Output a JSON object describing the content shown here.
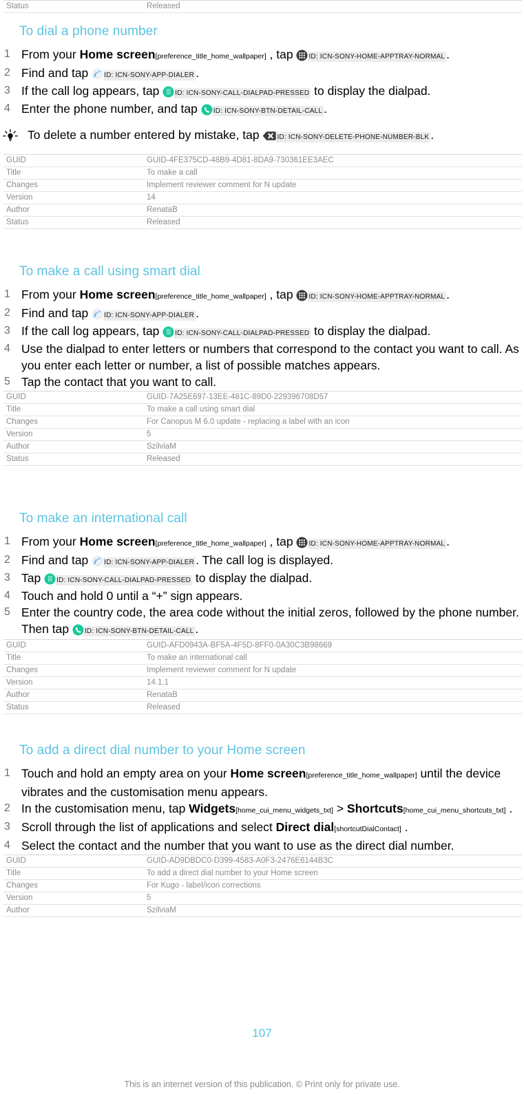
{
  "document": {
    "page_number": "107",
    "footer_note": "This is an internet version of this publication. © Print only for private use.",
    "heading_color": "#5cc3e0",
    "meta_text_color": "#8c8c8c"
  },
  "top_partial_table": {
    "rows": [
      {
        "key": "Status",
        "value": "Released"
      }
    ]
  },
  "sections": [
    {
      "id": "dial-a-phone-number",
      "heading": "To dial a phone number",
      "steps": [
        {
          "parts": [
            {
              "type": "text",
              "text": "From your "
            },
            {
              "type": "uilabel",
              "text": "Home screen"
            },
            {
              "type": "token",
              "text": "[preference_title_home_wallpaper]"
            },
            {
              "type": "text",
              "text": ", tap "
            },
            {
              "type": "icon",
              "icon": "apptray-grid-icon"
            },
            {
              "type": "idchip",
              "text": "ID: ICN-SONY-HOME-APPTRAY-NORMAL"
            },
            {
              "type": "text",
              "text": "."
            }
          ]
        },
        {
          "parts": [
            {
              "type": "text",
              "text": "Find and tap "
            },
            {
              "type": "icon",
              "icon": "dialer-app-icon"
            },
            {
              "type": "idchip",
              "text": "ID: ICN-SONY-APP-DIALER"
            },
            {
              "type": "text",
              "text": "."
            }
          ]
        },
        {
          "parts": [
            {
              "type": "text",
              "text": "If the call log appears, tap "
            },
            {
              "type": "icon",
              "icon": "dialpad-pressed-icon"
            },
            {
              "type": "idchip",
              "text": "ID: ICN-SONY-CALL-DIALPAD-PRESSED"
            },
            {
              "type": "text",
              "text": " to display the dialpad."
            }
          ]
        },
        {
          "parts": [
            {
              "type": "text",
              "text": "Enter the phone number, and tap "
            },
            {
              "type": "icon",
              "icon": "call-button-icon"
            },
            {
              "type": "idchip",
              "text": "ID: ICN-SONY-BTN-DETAIL-CALL"
            },
            {
              "type": "text",
              "text": "."
            }
          ]
        }
      ],
      "tip": {
        "icon": "lightbulb-tip-icon",
        "parts": [
          {
            "type": "text",
            "text": "To delete a number entered by mistake, tap "
          },
          {
            "type": "icon",
            "icon": "delete-backspace-icon"
          },
          {
            "type": "idchip",
            "text": "ID: ICN-SONY-DELETE-PHONE-NUMBER-BLK"
          },
          {
            "type": "text",
            "text": "."
          }
        ]
      },
      "meta": {
        "rows": [
          {
            "key": "GUID",
            "value": "GUID-4FE375CD-48B9-4D81-8DA9-730361EE3AEC"
          },
          {
            "key": "Title",
            "value": "To make a call"
          },
          {
            "key": "Changes",
            "value": "Implement reviewer comment for N update"
          },
          {
            "key": "Version",
            "value": "14"
          },
          {
            "key": "Author",
            "value": "RenataB"
          },
          {
            "key": "Status",
            "value": "Released"
          }
        ]
      }
    },
    {
      "id": "make-a-call-using-smart-dial",
      "heading": "To make a call using smart dial",
      "steps": [
        {
          "parts": [
            {
              "type": "text",
              "text": "From your "
            },
            {
              "type": "uilabel",
              "text": "Home screen"
            },
            {
              "type": "token",
              "text": "[preference_title_home_wallpaper]"
            },
            {
              "type": "text",
              "text": ", tap "
            },
            {
              "type": "icon",
              "icon": "apptray-grid-icon"
            },
            {
              "type": "idchip",
              "text": "ID: ICN-SONY-HOME-APPTRAY-NORMAL"
            },
            {
              "type": "text",
              "text": "."
            }
          ]
        },
        {
          "parts": [
            {
              "type": "text",
              "text": "Find and tap "
            },
            {
              "type": "icon",
              "icon": "dialer-app-icon"
            },
            {
              "type": "idchip",
              "text": "ID: ICN-SONY-APP-DIALER"
            },
            {
              "type": "text",
              "text": "."
            }
          ]
        },
        {
          "parts": [
            {
              "type": "text",
              "text": "If the call log appears, tap "
            },
            {
              "type": "icon",
              "icon": "dialpad-pressed-icon"
            },
            {
              "type": "idchip",
              "text": "ID: ICN-SONY-CALL-DIALPAD-PRESSED"
            },
            {
              "type": "text",
              "text": " to display the dialpad."
            }
          ]
        },
        {
          "parts": [
            {
              "type": "text",
              "text": "Use the dialpad to enter letters or numbers that correspond to the contact you want to call. As you enter each letter or number, a list of possible matches appears."
            }
          ]
        },
        {
          "parts": [
            {
              "type": "text",
              "text": "Tap the contact that you want to call."
            }
          ]
        }
      ],
      "meta": {
        "rows": [
          {
            "key": "GUID",
            "value": "GUID-7A25E697-13EE-481C-89D0-229396708D57"
          },
          {
            "key": "Title",
            "value": "To make a call using smart dial"
          },
          {
            "key": "Changes",
            "value": "For Canopus M 6.0 update - replacing a label with an icon"
          },
          {
            "key": "Version",
            "value": "5"
          },
          {
            "key": "Author",
            "value": "SzilviaM"
          },
          {
            "key": "Status",
            "value": "Released"
          }
        ]
      }
    },
    {
      "id": "make-an-international-call",
      "heading": "To make an international call",
      "steps": [
        {
          "parts": [
            {
              "type": "text",
              "text": "From your "
            },
            {
              "type": "uilabel",
              "text": "Home screen"
            },
            {
              "type": "token",
              "text": "[preference_title_home_wallpaper]"
            },
            {
              "type": "text",
              "text": ", tap "
            },
            {
              "type": "icon",
              "icon": "apptray-grid-icon"
            },
            {
              "type": "idchip",
              "text": "ID: ICN-SONY-HOME-APPTRAY-NORMAL"
            },
            {
              "type": "text",
              "text": "."
            }
          ]
        },
        {
          "parts": [
            {
              "type": "text",
              "text": "Find and tap "
            },
            {
              "type": "icon",
              "icon": "dialer-app-icon"
            },
            {
              "type": "idchip",
              "text": "ID: ICN-SONY-APP-DIALER"
            },
            {
              "type": "text",
              "text": ". The call log is displayed."
            }
          ]
        },
        {
          "parts": [
            {
              "type": "text",
              "text": "Tap "
            },
            {
              "type": "icon",
              "icon": "dialpad-pressed-icon"
            },
            {
              "type": "idchip",
              "text": "ID: ICN-SONY-CALL-DIALPAD-PRESSED"
            },
            {
              "type": "text",
              "text": " to display the dialpad."
            }
          ]
        },
        {
          "parts": [
            {
              "type": "text",
              "text": "Touch and hold 0 until a “+” sign appears."
            }
          ]
        },
        {
          "parts": [
            {
              "type": "text",
              "text": "Enter the country code, the area code without the initial zeros, followed by the phone number. Then tap "
            },
            {
              "type": "icon",
              "icon": "call-button-icon"
            },
            {
              "type": "idchip",
              "text": "ID: ICN-SONY-BTN-DETAIL-CALL"
            },
            {
              "type": "text",
              "text": "."
            }
          ]
        }
      ],
      "meta": {
        "rows": [
          {
            "key": "GUID",
            "value": "GUID-AFD0943A-BF5A-4F5D-8FF0-0A30C3B98669"
          },
          {
            "key": "Title",
            "value": "To make an international call"
          },
          {
            "key": "Changes",
            "value": "Implement reviewer comment for N update"
          },
          {
            "key": "Version",
            "value": "14.1.1"
          },
          {
            "key": "Author",
            "value": "RenataB"
          },
          {
            "key": "Status",
            "value": "Released"
          }
        ]
      }
    },
    {
      "id": "add-a-direct-dial-number",
      "heading": "To add a direct dial number to your Home screen",
      "steps": [
        {
          "parts": [
            {
              "type": "text",
              "text": "Touch and hold an empty area on your "
            },
            {
              "type": "uilabel",
              "text": "Home screen"
            },
            {
              "type": "token",
              "text": "[preference_title_home_wallpaper]"
            },
            {
              "type": "text",
              "text": " until the device vibrates and the customisation menu appears."
            }
          ]
        },
        {
          "parts": [
            {
              "type": "text",
              "text": "In the customisation menu, tap "
            },
            {
              "type": "uilabel",
              "text": "Widgets"
            },
            {
              "type": "token",
              "text": "[home_cui_menu_widgets_txt]"
            },
            {
              "type": "text",
              "text": " > "
            },
            {
              "type": "uilabel",
              "text": "Shortcuts"
            },
            {
              "type": "token",
              "text": "[home_cui_menu_shortcuts_txt]"
            },
            {
              "type": "text",
              "text": "."
            }
          ]
        },
        {
          "parts": [
            {
              "type": "text",
              "text": "Scroll through the list of applications and select "
            },
            {
              "type": "uilabel",
              "text": "Direct dial"
            },
            {
              "type": "token",
              "text": "[shortcutDialContact]"
            },
            {
              "type": "text",
              "text": "."
            }
          ]
        },
        {
          "parts": [
            {
              "type": "text",
              "text": "Select the contact and the number that you want to use as the direct dial number."
            }
          ]
        }
      ],
      "meta": {
        "rows": [
          {
            "key": "GUID",
            "value": "GUID-AD9DBDC0-D399-4583-A0F3-2476E6144B3C"
          },
          {
            "key": "Title",
            "value": "To add a direct dial number to your Home screen"
          },
          {
            "key": "Changes",
            "value": "For Kugo - label/icon corrections"
          },
          {
            "key": "Version",
            "value": "5"
          },
          {
            "key": "Author",
            "value": "SzilviaM"
          }
        ]
      }
    }
  ],
  "icons": {
    "apptray-grid-icon": "circle with 3x3 white dot grid",
    "dialer-app-icon": "light blue phone with keypad",
    "dialpad-pressed-icon": "green circle with keypad dots",
    "call-button-icon": "green circle with phone handset",
    "delete-backspace-icon": "dark backspace key with X",
    "lightbulb-tip-icon": "light bulb with rays"
  }
}
